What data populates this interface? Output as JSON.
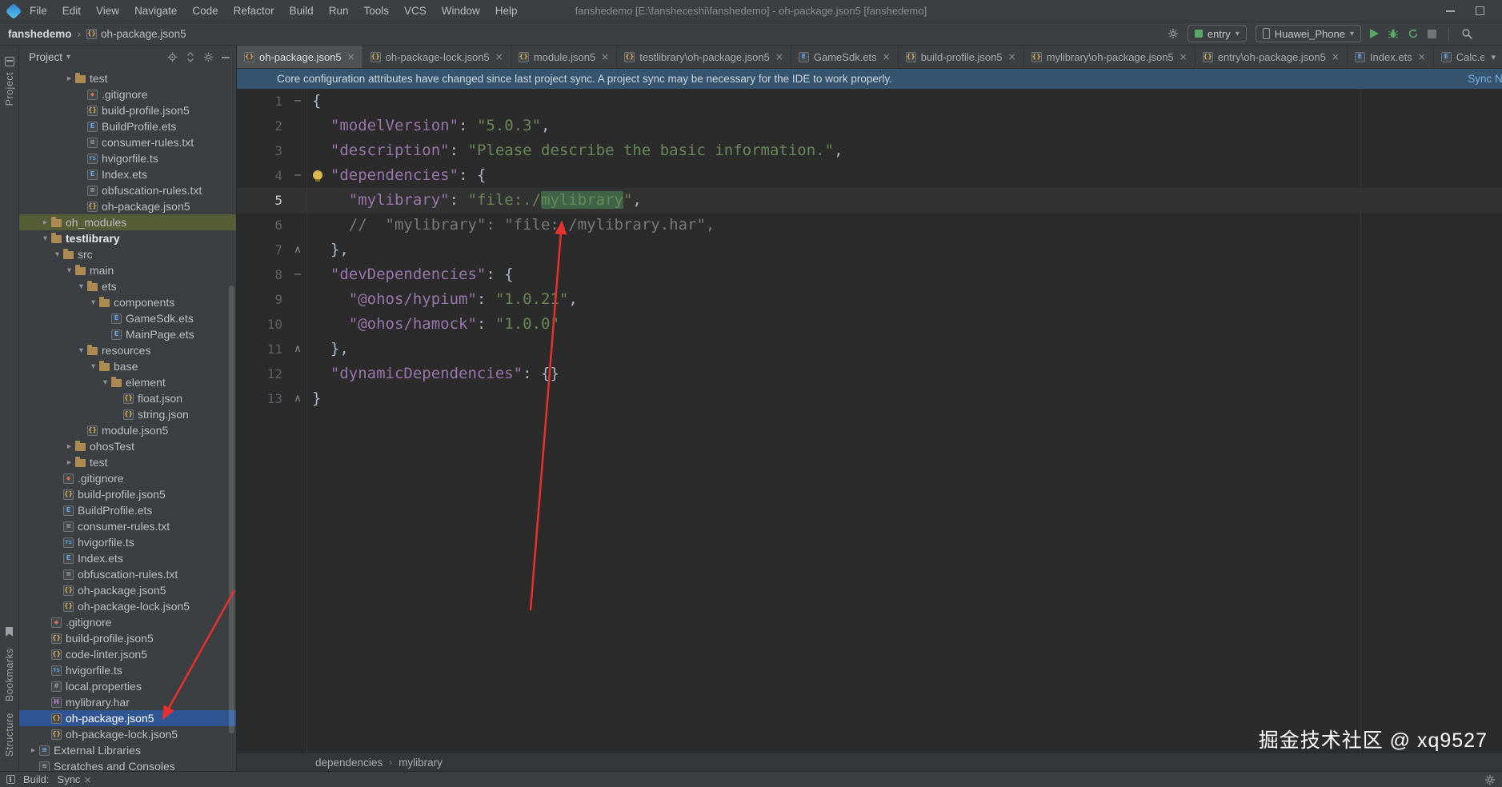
{
  "window": {
    "title": "fanshedemo [E:\\fansheceshi\\fanshedemo] - oh-package.json5 [fanshedemo]",
    "menus": [
      "File",
      "Edit",
      "View",
      "Navigate",
      "Code",
      "Refactor",
      "Build",
      "Run",
      "Tools",
      "VCS",
      "Window",
      "Help"
    ]
  },
  "toolbar": {
    "project_crumb": "fanshedemo",
    "file_crumb": "oh-package.json5",
    "module_selector": "entry",
    "device_selector": "Huawei_Phone"
  },
  "tabs": [
    {
      "label": "oh-package.json5",
      "icon": "json5",
      "active": true
    },
    {
      "label": "oh-package-lock.json5",
      "icon": "json5"
    },
    {
      "label": "module.json5",
      "icon": "json5"
    },
    {
      "label": "testlibrary\\oh-package.json5",
      "icon": "json5"
    },
    {
      "label": "GameSdk.ets",
      "icon": "ets"
    },
    {
      "label": "build-profile.json5",
      "icon": "json5"
    },
    {
      "label": "mylibrary\\oh-package.json5",
      "icon": "json5"
    },
    {
      "label": "entry\\oh-package.json5",
      "icon": "json5"
    },
    {
      "label": "Index.ets",
      "icon": "ets"
    },
    {
      "label": "Calc.et",
      "icon": "ets"
    }
  ],
  "banner": {
    "message": "Core configuration attributes have changed since last project sync. A project sync may be necessary for the IDE to work properly.",
    "action": "Sync Now"
  },
  "stripes": {
    "top": "Project",
    "bottom": [
      "Bookmarks",
      "Structure"
    ]
  },
  "project": {
    "header": "Project",
    "tree": [
      {
        "l": "test",
        "i": "folder",
        "d": 3,
        "c": "r"
      },
      {
        "l": ".gitignore",
        "i": "git",
        "d": 4
      },
      {
        "l": "build-profile.json5",
        "i": "json5",
        "d": 4
      },
      {
        "l": "BuildProfile.ets",
        "i": "ets",
        "d": 4
      },
      {
        "l": "consumer-rules.txt",
        "i": "txt",
        "d": 4
      },
      {
        "l": "hvigorfile.ts",
        "i": "ts",
        "d": 4
      },
      {
        "l": "Index.ets",
        "i": "ets",
        "d": 4
      },
      {
        "l": "obfuscation-rules.txt",
        "i": "txt",
        "d": 4
      },
      {
        "l": "oh-package.json5",
        "i": "json5",
        "d": 4
      },
      {
        "l": "oh_modules",
        "i": "folder",
        "d": 1,
        "c": "r",
        "hi": true
      },
      {
        "l": "testlibrary",
        "i": "folder",
        "d": 1,
        "c": "d",
        "b": true
      },
      {
        "l": "src",
        "i": "folder",
        "d": 2,
        "c": "d"
      },
      {
        "l": "main",
        "i": "folder",
        "d": 3,
        "c": "d"
      },
      {
        "l": "ets",
        "i": "folder",
        "d": 4,
        "c": "d"
      },
      {
        "l": "components",
        "i": "folder",
        "d": 5,
        "c": "d"
      },
      {
        "l": "GameSdk.ets",
        "i": "ets",
        "d": 6
      },
      {
        "l": "MainPage.ets",
        "i": "ets",
        "d": 6
      },
      {
        "l": "resources",
        "i": "folder",
        "d": 4,
        "c": "d"
      },
      {
        "l": "base",
        "i": "folder",
        "d": 5,
        "c": "d"
      },
      {
        "l": "element",
        "i": "folder",
        "d": 6,
        "c": "d"
      },
      {
        "l": "float.json",
        "i": "json",
        "d": 7
      },
      {
        "l": "string.json",
        "i": "json",
        "d": 7
      },
      {
        "l": "module.json5",
        "i": "json5",
        "d": 4
      },
      {
        "l": "ohosTest",
        "i": "folder",
        "d": 3,
        "c": "r"
      },
      {
        "l": "test",
        "i": "folder",
        "d": 3,
        "c": "r"
      },
      {
        "l": ".gitignore",
        "i": "git",
        "d": 2
      },
      {
        "l": "build-profile.json5",
        "i": "json5",
        "d": 2
      },
      {
        "l": "BuildProfile.ets",
        "i": "ets",
        "d": 2
      },
      {
        "l": "consumer-rules.txt",
        "i": "txt",
        "d": 2
      },
      {
        "l": "hvigorfile.ts",
        "i": "ts",
        "d": 2
      },
      {
        "l": "Index.ets",
        "i": "ets",
        "d": 2
      },
      {
        "l": "obfuscation-rules.txt",
        "i": "txt",
        "d": 2
      },
      {
        "l": "oh-package.json5",
        "i": "json5",
        "d": 2
      },
      {
        "l": "oh-package-lock.json5",
        "i": "json5",
        "d": 2
      },
      {
        "l": ".gitignore",
        "i": "git",
        "d": 1
      },
      {
        "l": "build-profile.json5",
        "i": "json5",
        "d": 1
      },
      {
        "l": "code-linter.json5",
        "i": "json5",
        "d": 1
      },
      {
        "l": "hvigorfile.ts",
        "i": "ts",
        "d": 1
      },
      {
        "l": "local.properties",
        "i": "props",
        "d": 1
      },
      {
        "l": "mylibrary.har",
        "i": "har",
        "d": 1
      },
      {
        "l": "oh-package.json5",
        "i": "json5",
        "d": 1,
        "sel": true
      },
      {
        "l": "oh-package-lock.json5",
        "i": "json5",
        "d": 1
      },
      {
        "l": "External Libraries",
        "i": "lib",
        "d": 0,
        "c": "r"
      },
      {
        "l": "Scratches and Consoles",
        "i": "scratch",
        "d": 0
      }
    ]
  },
  "editor": {
    "breadcrumbs": [
      "dependencies",
      "mylibrary"
    ],
    "lines": [
      {
        "n": 1,
        "fold": "open",
        "tokens": [
          [
            "p",
            "{"
          ]
        ]
      },
      {
        "n": 2,
        "tokens": [
          [
            "w",
            "  "
          ],
          [
            "k",
            "\"modelVersion\""
          ],
          [
            "p",
            ": "
          ],
          [
            "s",
            "\"5.0.3\""
          ],
          [
            "p",
            ","
          ]
        ]
      },
      {
        "n": 3,
        "tokens": [
          [
            "w",
            "  "
          ],
          [
            "k",
            "\"description\""
          ],
          [
            "p",
            ": "
          ],
          [
            "s",
            "\"Please describe the basic information.\""
          ],
          [
            "p",
            ","
          ]
        ]
      },
      {
        "n": 4,
        "fold": "open",
        "bulb": true,
        "tokens": [
          [
            "w",
            "  "
          ],
          [
            "k",
            "\"dependencies\""
          ],
          [
            "p",
            ": "
          ],
          [
            "p",
            "{"
          ]
        ]
      },
      {
        "n": 5,
        "caret": true,
        "tokens": [
          [
            "w",
            "    "
          ],
          [
            "k",
            "\"mylibrary\""
          ],
          [
            "p",
            ": "
          ],
          [
            "s",
            "\"file:./"
          ],
          [
            "s hl",
            "mylibrary"
          ],
          [
            "s",
            "\""
          ],
          [
            "p",
            ","
          ]
        ]
      },
      {
        "n": 6,
        "tokens": [
          [
            "w",
            "    "
          ],
          [
            "c",
            "//  \"mylibrary\": \"file:./mylibrary.har\","
          ]
        ]
      },
      {
        "n": 7,
        "fold": "end",
        "tokens": [
          [
            "w",
            "  "
          ],
          [
            "p",
            "},"
          ]
        ]
      },
      {
        "n": 8,
        "fold": "open",
        "tokens": [
          [
            "w",
            "  "
          ],
          [
            "k",
            "\"devDependencies\""
          ],
          [
            "p",
            ": "
          ],
          [
            "p",
            "{"
          ]
        ]
      },
      {
        "n": 9,
        "tokens": [
          [
            "w",
            "    "
          ],
          [
            "k",
            "\"@ohos/hypium\""
          ],
          [
            "p",
            ": "
          ],
          [
            "s",
            "\"1.0.21\""
          ],
          [
            "p",
            ","
          ]
        ]
      },
      {
        "n": 10,
        "tokens": [
          [
            "w",
            "    "
          ],
          [
            "k",
            "\"@ohos/hamock\""
          ],
          [
            "p",
            ": "
          ],
          [
            "s",
            "\"1.0.0\""
          ]
        ]
      },
      {
        "n": 11,
        "fold": "end",
        "tokens": [
          [
            "w",
            "  "
          ],
          [
            "p",
            "},"
          ]
        ]
      },
      {
        "n": 12,
        "tokens": [
          [
            "w",
            "  "
          ],
          [
            "k",
            "\"dynamicDependencies\""
          ],
          [
            "p",
            ": "
          ],
          [
            "p",
            "{}"
          ]
        ]
      },
      {
        "n": 13,
        "fold": "end",
        "tokens": [
          [
            "p",
            "}"
          ]
        ]
      }
    ]
  },
  "status": {
    "build_label": "Build:",
    "build_tab": "Sync"
  },
  "watermark": "掘金技术社区 @ xq9527"
}
